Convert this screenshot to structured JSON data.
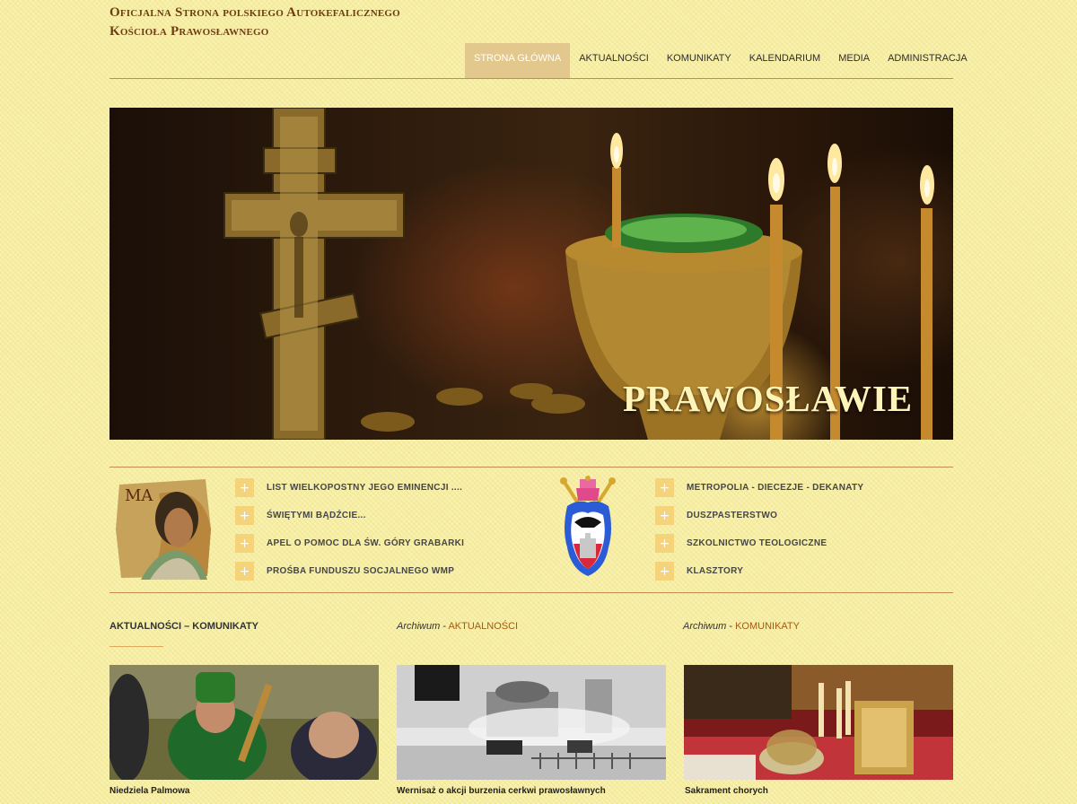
{
  "header": {
    "title_line1": "Oficjalna Strona polskiego Autokefalicznego",
    "title_line2": "Kościoła Prawosławnego"
  },
  "nav": {
    "items": [
      {
        "label": "STRONA GŁÓWNA",
        "active": true
      },
      {
        "label": "AKTUALNOŚCI",
        "active": false
      },
      {
        "label": "KOMUNIKATY",
        "active": false
      },
      {
        "label": "KALENDARIUM",
        "active": false
      },
      {
        "label": "MEDIA",
        "active": false
      },
      {
        "label": "ADMINISTRACJA",
        "active": false
      }
    ]
  },
  "hero": {
    "caption": "PRAWOSŁAWIE"
  },
  "links_left": [
    "LIST WIELKOPOSTNY JEGO EMINENCJI ....",
    "ŚWIĘTYMI BĄDŹCIE...",
    "APEL O POMOC DLA ŚW. GÓRY GRABARKI",
    "PROŚBA FUNDUSZU SOCJALNEGO WMP"
  ],
  "links_right": [
    "METROPOLIA - DIECEZJE - DEKANATY",
    "DUSZPASTERSTWO",
    "SZKOLNICTWO TEOLOGICZNE",
    "KLASZTORY"
  ],
  "icons": {
    "plus": "+",
    "icon_letters": "MA"
  },
  "bottom": {
    "section_title": "AKTUALNOŚCI – KOMUNIKATY",
    "archive_word": "Archiwum",
    "archive_sep": " - ",
    "archive1_link": "AKTUALNOŚCI",
    "archive2_link": "KOMUNIKATY",
    "news": [
      {
        "caption": "Niedziela Palmowa"
      },
      {
        "caption": "Wernisaż o akcji burzenia cerkwi prawosławnych"
      },
      {
        "caption": "Sakrament chorych"
      }
    ]
  },
  "colors": {
    "background": "#f9ef9f",
    "accent_line": "#c98b4d",
    "title_brown": "#6e3d12",
    "nav_active": "#e3c88d",
    "plus_box": "#f4d37a",
    "link_orange": "#a35a12"
  }
}
